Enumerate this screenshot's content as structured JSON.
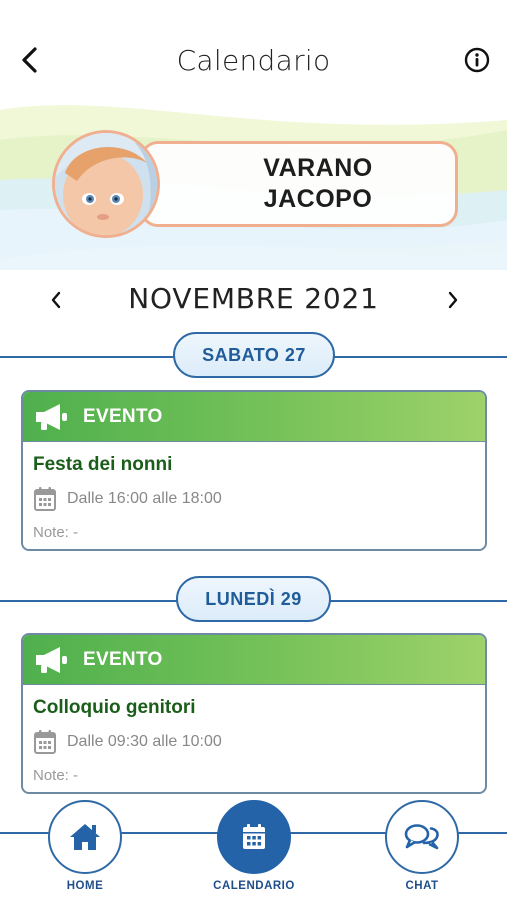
{
  "header": {
    "title": "Calendario",
    "back_icon": "chevron-left-icon",
    "info_icon": "info-icon"
  },
  "profile": {
    "first_line": "VARANO",
    "second_line": "JACOPO",
    "avatar": "child-photo"
  },
  "month_nav": {
    "label": "NOVEMBRE 2021",
    "prev_icon": "chevron-left-icon",
    "next_icon": "chevron-right-icon"
  },
  "days": [
    {
      "label": "SABATO 27",
      "events": [
        {
          "type": "EVENTO",
          "title": "Festa dei nonni",
          "time": "Dalle 16:00 alle 18:00",
          "note": "Note: -"
        }
      ]
    },
    {
      "label": "LUNEDÌ 29",
      "events": [
        {
          "type": "EVENTO",
          "title": "Colloquio genitori",
          "time": "Dalle 09:30 alle 10:00",
          "note": "Note: -"
        }
      ]
    }
  ],
  "tabbar": {
    "items": [
      {
        "label": "HOME",
        "icon": "home-icon",
        "active": false
      },
      {
        "label": "CALENDARIO",
        "icon": "calendar-icon",
        "active": true
      },
      {
        "label": "CHAT",
        "icon": "chat-icon",
        "active": false
      }
    ]
  },
  "colors": {
    "accent": "#2463a8",
    "event_green": "#5cb550",
    "border_orange": "#f0b08f"
  }
}
